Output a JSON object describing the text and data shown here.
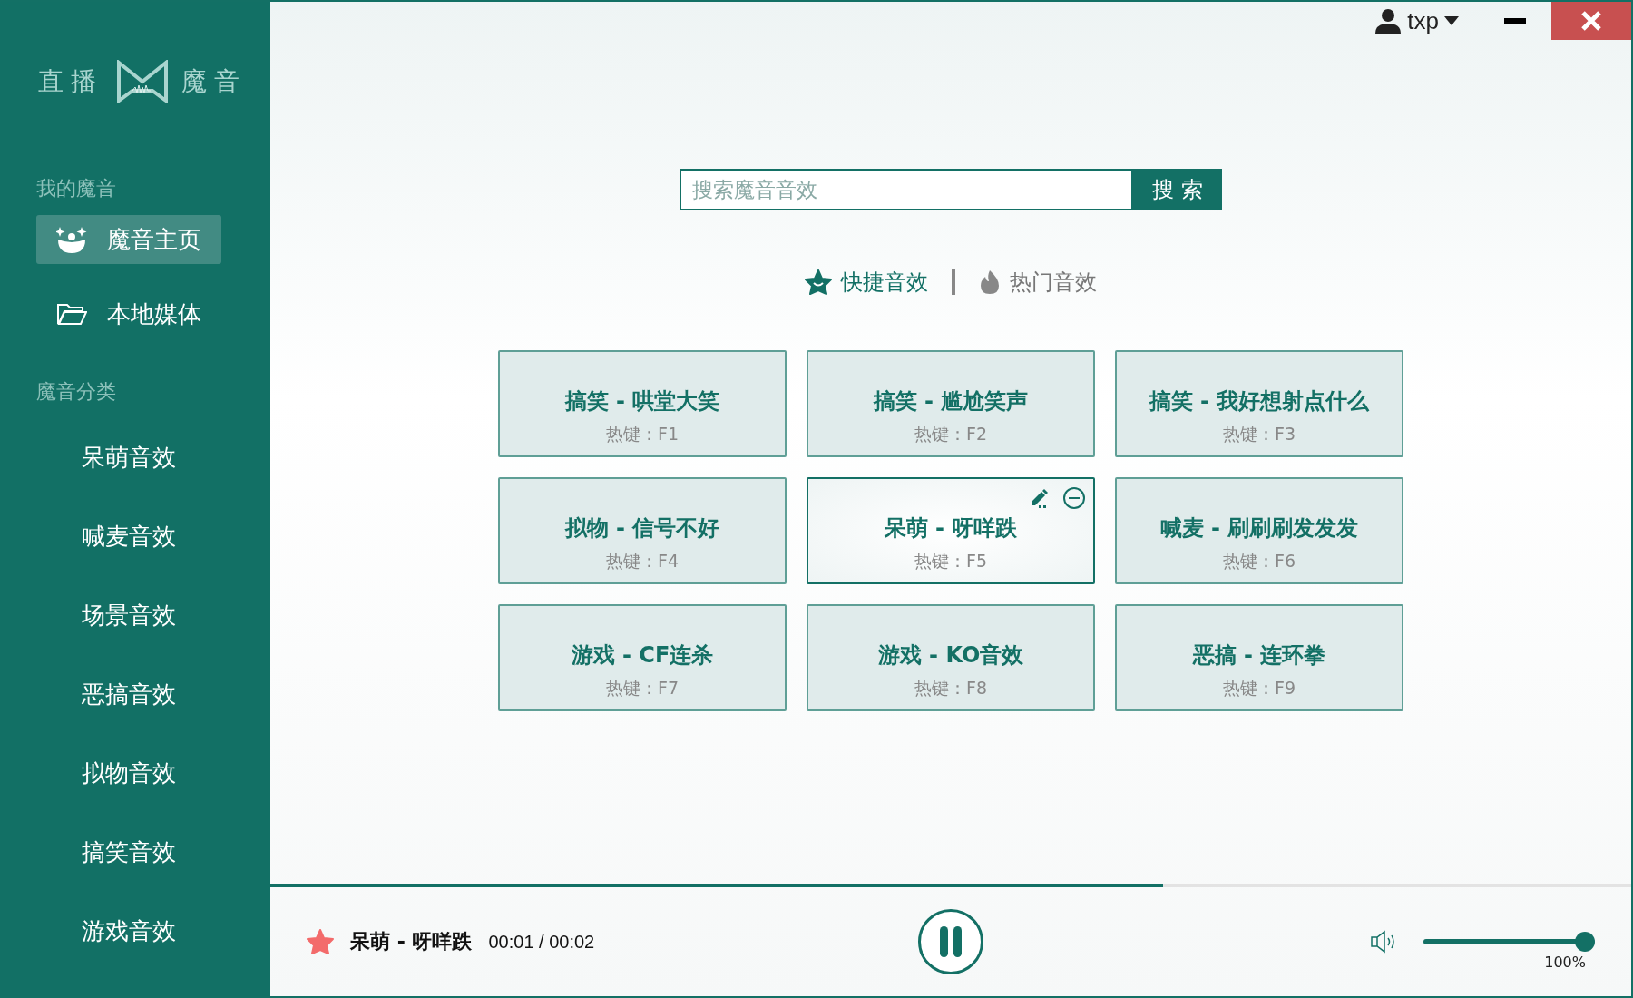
{
  "logo": {
    "left": "直播",
    "right": "魔音"
  },
  "sidebar": {
    "section_1": "我的魔音",
    "items": [
      {
        "label": "魔音主页",
        "kind": "home",
        "selected": true
      },
      {
        "label": "本地媒体",
        "kind": "folder",
        "selected": false
      }
    ],
    "section_2": "魔音分类",
    "categories": [
      {
        "label": "呆萌音效",
        "selected": false
      },
      {
        "label": "喊麦音效",
        "selected": false
      },
      {
        "label": "场景音效",
        "selected": false
      },
      {
        "label": "恶搞音效",
        "selected": false
      },
      {
        "label": "拟物音效",
        "selected": false
      },
      {
        "label": "搞笑音效",
        "selected": false
      },
      {
        "label": "游戏音效",
        "selected": false
      }
    ]
  },
  "user": {
    "name": "txp"
  },
  "search": {
    "placeholder": "搜索魔音音效",
    "button": "搜 索"
  },
  "tabs": [
    {
      "label": "快捷音效",
      "kind": "quick",
      "selected": true
    },
    {
      "label": "热门音效",
      "kind": "hot",
      "selected": false
    }
  ],
  "cards": [
    {
      "title": "搞笑 - 哄堂大笑",
      "hotkey": "热键：F1",
      "selected": false
    },
    {
      "title": "搞笑 - 尴尬笑声",
      "hotkey": "热键：F2",
      "selected": false
    },
    {
      "title": "搞笑 - 我好想射点什么",
      "hotkey": "热键：F3",
      "selected": false
    },
    {
      "title": "拟物 - 信号不好",
      "hotkey": "热键：F4",
      "selected": false
    },
    {
      "title": "呆萌 - 呀咩跌",
      "hotkey": "热键：F5",
      "selected": true
    },
    {
      "title": "喊麦 - 刷刷刷发发发",
      "hotkey": "热键：F6",
      "selected": false
    },
    {
      "title": "游戏 - CF连杀",
      "hotkey": "热键：F7",
      "selected": false
    },
    {
      "title": "游戏 - KO音效",
      "hotkey": "热键：F8",
      "selected": false
    },
    {
      "title": "恶搞 - 连环拳",
      "hotkey": "热键：F9",
      "selected": false
    }
  ],
  "player": {
    "title": "呆萌 - 呀咩跌",
    "time": "00:01 / 00:02",
    "level": 0.656,
    "playing": true,
    "favorite": true,
    "volume": {
      "level": 1,
      "reading": "100%"
    }
  }
}
